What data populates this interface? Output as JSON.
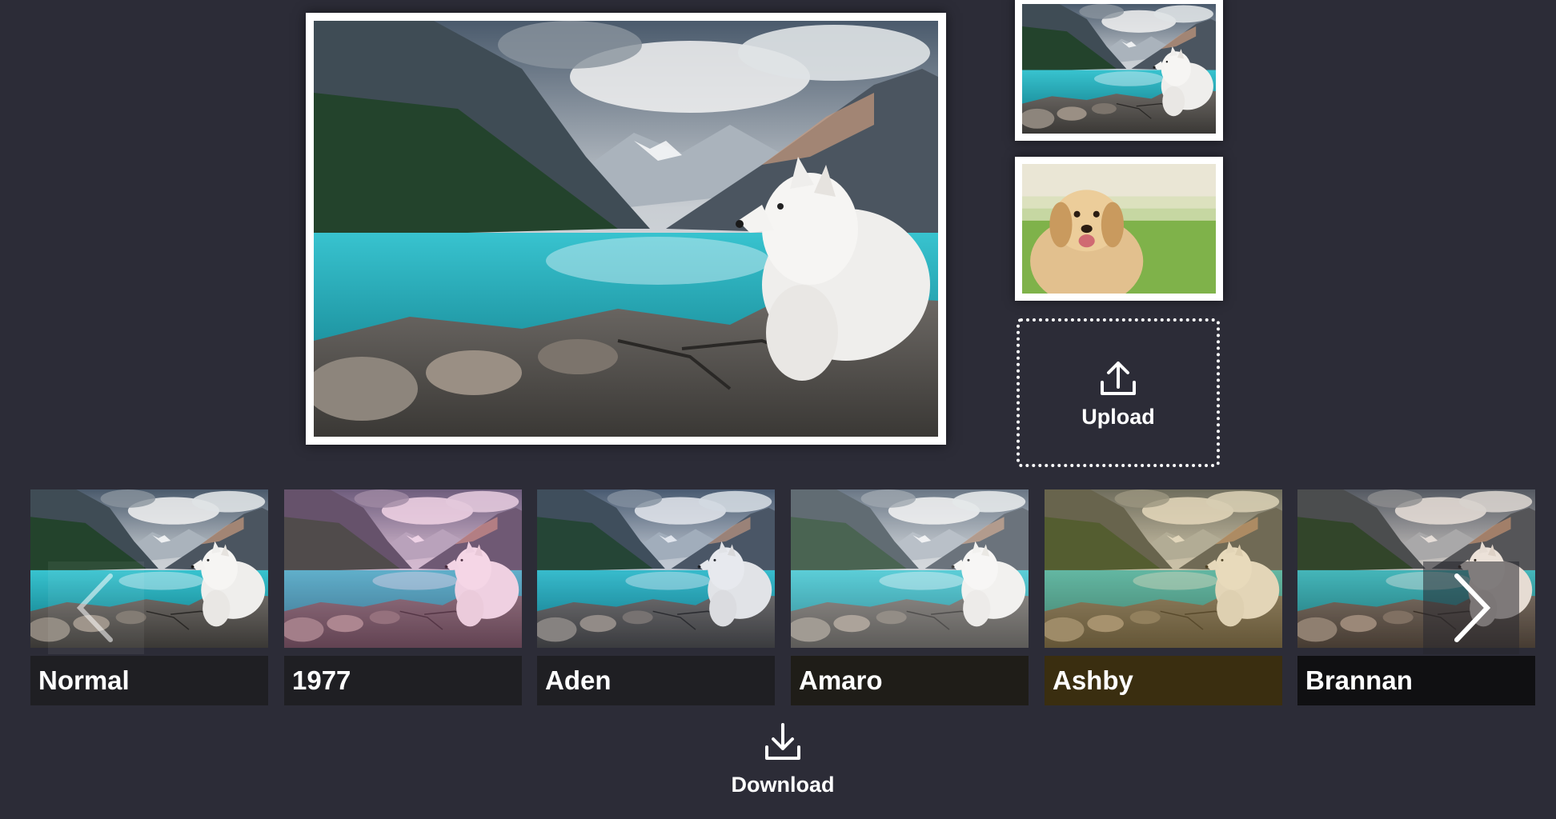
{
  "upload": {
    "label": "Upload",
    "icon": "upload-icon"
  },
  "download": {
    "label": "Download",
    "icon": "download-icon"
  },
  "side_thumbnails": [
    {
      "subject": "samoyed-lake-photo"
    },
    {
      "subject": "golden-retriever-photo"
    }
  ],
  "filters": [
    {
      "label": "Normal",
      "tint": "#000000",
      "tint_opacity": 0,
      "caption_bg": "#1f1f23"
    },
    {
      "label": "1977",
      "tint": "#f36abc",
      "tint_opacity": 0.22,
      "caption_bg": "#1f1f23"
    },
    {
      "label": "Aden",
      "tint": "#4263b8",
      "tint_opacity": 0.08,
      "caption_bg": "#1f1f23"
    },
    {
      "label": "Amaro",
      "tint": "#ffffff",
      "tint_opacity": 0.18,
      "caption_bg": "#1f1d18"
    },
    {
      "label": "Ashby",
      "tint": "#c89a3a",
      "tint_opacity": 0.3,
      "caption_bg": "#3a2e10"
    },
    {
      "label": "Brannan",
      "tint": "#a15c1e",
      "tint_opacity": 0.12,
      "caption_bg": "#101012"
    }
  ],
  "colors": {
    "background": "#2c2c37",
    "lake": "#2fb4c2",
    "mountain_dark": "#3f4c55",
    "forest": "#23432c",
    "frame": "#ffffff"
  }
}
